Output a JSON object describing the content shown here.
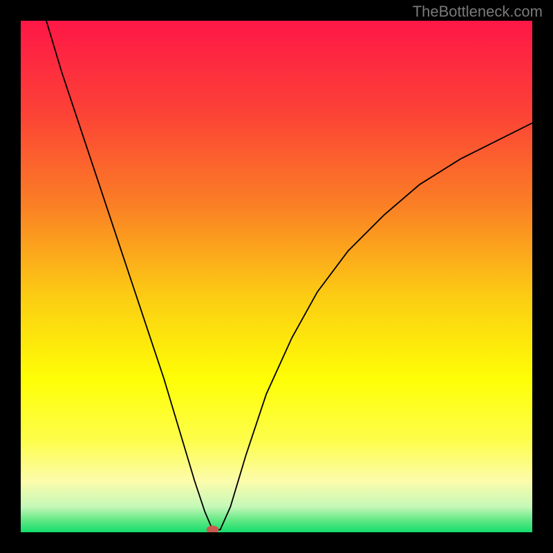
{
  "watermark": "TheBottleneck.com",
  "chart_data": {
    "type": "line",
    "title": "",
    "xlabel": "",
    "ylabel": "",
    "xlim": [
      0,
      100
    ],
    "ylim": [
      0,
      100
    ],
    "background_gradient": {
      "stops": [
        {
          "offset": 0.0,
          "color": "#fe1747"
        },
        {
          "offset": 0.18,
          "color": "#fc4236"
        },
        {
          "offset": 0.36,
          "color": "#fb7f25"
        },
        {
          "offset": 0.54,
          "color": "#fccd13"
        },
        {
          "offset": 0.7,
          "color": "#fefe05"
        },
        {
          "offset": 0.82,
          "color": "#fdfd4b"
        },
        {
          "offset": 0.9,
          "color": "#fcfcac"
        },
        {
          "offset": 0.95,
          "color": "#c5f8b8"
        },
        {
          "offset": 0.975,
          "color": "#67e987"
        },
        {
          "offset": 1.0,
          "color": "#14dd6b"
        }
      ]
    },
    "series": [
      {
        "name": "bottleneck-curve",
        "color": "#000000",
        "points": [
          {
            "x": 5,
            "y": 100
          },
          {
            "x": 8,
            "y": 90
          },
          {
            "x": 12,
            "y": 78
          },
          {
            "x": 16,
            "y": 66
          },
          {
            "x": 20,
            "y": 54
          },
          {
            "x": 24,
            "y": 42
          },
          {
            "x": 28,
            "y": 30
          },
          {
            "x": 31,
            "y": 20
          },
          {
            "x": 34,
            "y": 10
          },
          {
            "x": 36,
            "y": 4
          },
          {
            "x": 37.5,
            "y": 0.5
          },
          {
            "x": 39,
            "y": 0.5
          },
          {
            "x": 41,
            "y": 5
          },
          {
            "x": 44,
            "y": 15
          },
          {
            "x": 48,
            "y": 27
          },
          {
            "x": 53,
            "y": 38
          },
          {
            "x": 58,
            "y": 47
          },
          {
            "x": 64,
            "y": 55
          },
          {
            "x": 71,
            "y": 62
          },
          {
            "x": 78,
            "y": 68
          },
          {
            "x": 86,
            "y": 73
          },
          {
            "x": 94,
            "y": 77
          },
          {
            "x": 100,
            "y": 80
          }
        ]
      }
    ],
    "marker": {
      "x": 37.5,
      "y": 0.5,
      "color": "#c9594e",
      "rx": 1.2,
      "ry": 0.8
    }
  }
}
